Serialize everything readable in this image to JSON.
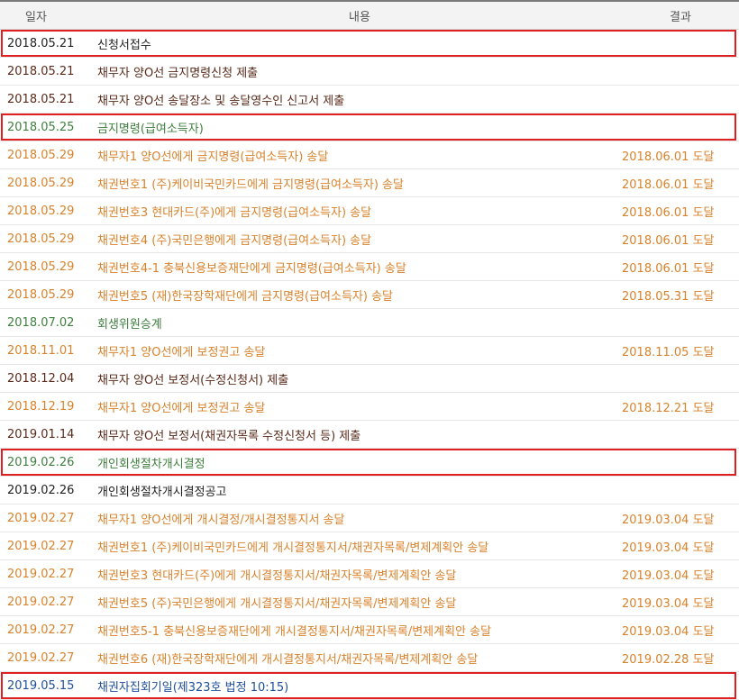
{
  "header": {
    "date": "일자",
    "content": "내용",
    "result": "결과"
  },
  "rows": [
    {
      "date": "2018.05.21",
      "content": "신청서접수",
      "result": "",
      "color": "#222222"
    },
    {
      "date": "2018.05.21",
      "content": "채무자 양O선 금지명령신청 제출",
      "result": "",
      "color": "#5a2a1a"
    },
    {
      "date": "2018.05.21",
      "content": "채무자 양O선 송달장소 및 송달영수인 신고서 제출",
      "result": "",
      "color": "#5a2a1a"
    },
    {
      "date": "2018.05.25",
      "content": "금지명령(급여소득자)",
      "result": "",
      "color": "#3e7f3e"
    },
    {
      "date": "2018.05.29",
      "content": "채무자1 양O선에게 금지명령(급여소득자) 송달",
      "result": "2018.06.01 도달",
      "color": "#d9822b"
    },
    {
      "date": "2018.05.29",
      "content": "채권번호1 (주)케이비국민카드에게 금지명령(급여소득자) 송달",
      "result": "2018.06.01 도달",
      "color": "#d9822b"
    },
    {
      "date": "2018.05.29",
      "content": "채권번호3 현대카드(주)에게 금지명령(급여소득자) 송달",
      "result": "2018.06.01 도달",
      "color": "#d9822b"
    },
    {
      "date": "2018.05.29",
      "content": "채권번호4 (주)국민은행에게 금지명령(급여소득자) 송달",
      "result": "2018.06.01 도달",
      "color": "#d9822b"
    },
    {
      "date": "2018.05.29",
      "content": "채권번호4-1 충북신용보증재단에게 금지명령(급여소득자) 송달",
      "result": "2018.06.01 도달",
      "color": "#d9822b"
    },
    {
      "date": "2018.05.29",
      "content": "채권번호5 (재)한국장학재단에게 금지명령(급여소득자) 송달",
      "result": "2018.05.31 도달",
      "color": "#d9822b"
    },
    {
      "date": "2018.07.02",
      "content": "회생위원승계",
      "result": "",
      "color": "#3e7f3e"
    },
    {
      "date": "2018.11.01",
      "content": "채무자1 양O선에게 보정권고 송달",
      "result": "2018.11.05 도달",
      "color": "#d9822b"
    },
    {
      "date": "2018.12.04",
      "content": "채무자 양O선 보정서(수정신청서) 제출",
      "result": "",
      "color": "#5a2a1a"
    },
    {
      "date": "2018.12.19",
      "content": "채무자1 양O선에게 보정권고 송달",
      "result": "2018.12.21 도달",
      "color": "#d9822b"
    },
    {
      "date": "2019.01.14",
      "content": "채무자 양O선 보정서(채권자목록 수정신청서 등) 제출",
      "result": "",
      "color": "#5a2a1a"
    },
    {
      "date": "2019.02.26",
      "content": "개인회생절차개시결정",
      "result": "",
      "color": "#3e7f3e"
    },
    {
      "date": "2019.02.26",
      "content": "개인회생절차개시결정공고",
      "result": "",
      "color": "#222222"
    },
    {
      "date": "2019.02.27",
      "content": "채무자1 양O선에게 개시결정/개시결정통지서 송달",
      "result": "2019.03.04 도달",
      "color": "#d9822b"
    },
    {
      "date": "2019.02.27",
      "content": "채권번호1 (주)케이비국민카드에게 개시결정통지서/채권자목록/변제계획안 송달",
      "result": "2019.03.04 도달",
      "color": "#d9822b"
    },
    {
      "date": "2019.02.27",
      "content": "채권번호3 현대카드(주)에게 개시결정통지서/채권자목록/변제계획안 송달",
      "result": "2019.03.04 도달",
      "color": "#d9822b"
    },
    {
      "date": "2019.02.27",
      "content": "채권번호5 (주)국민은행에게 개시결정통지서/채권자목록/변제계획안 송달",
      "result": "2019.03.04 도달",
      "color": "#d9822b"
    },
    {
      "date": "2019.02.27",
      "content": "채권번호5-1 충북신용보증재단에게 개시결정통지서/채권자목록/변제계획안 송달",
      "result": "2019.03.04 도달",
      "color": "#d9822b"
    },
    {
      "date": "2019.02.27",
      "content": "채권번호6 (재)한국장학재단에게 개시결정통지서/채권자목록/변제계획안 송달",
      "result": "2019.02.28 도달",
      "color": "#d9822b"
    },
    {
      "date": "2019.05.15",
      "content": "채권자집회기일(제323호 법정 10:15)",
      "result": "",
      "color": "#1f4f9a"
    }
  ],
  "highlight_color": "#e02020",
  "highlighted_rows": [
    0,
    3,
    15,
    23
  ]
}
